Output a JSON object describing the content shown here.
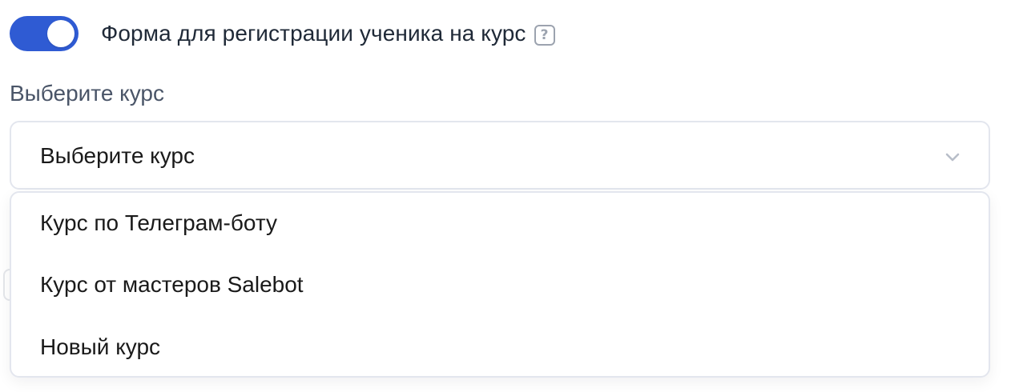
{
  "toggle": {
    "state": "on",
    "label": "Форма для регистрации ученика на курс",
    "help": "?"
  },
  "course_field": {
    "label": "Выберите курс",
    "placeholder": "Выберите курс",
    "options": [
      "Курс по Телеграм-боту",
      "Курс от мастеров Salebot",
      "Новый курс"
    ]
  },
  "colors": {
    "accent": "#2f5bd3",
    "border": "#e3e6ee",
    "label_text": "#4a5568",
    "icon": "#9ca3af"
  },
  "icons": [
    "help-icon",
    "chevron-down-icon"
  ]
}
